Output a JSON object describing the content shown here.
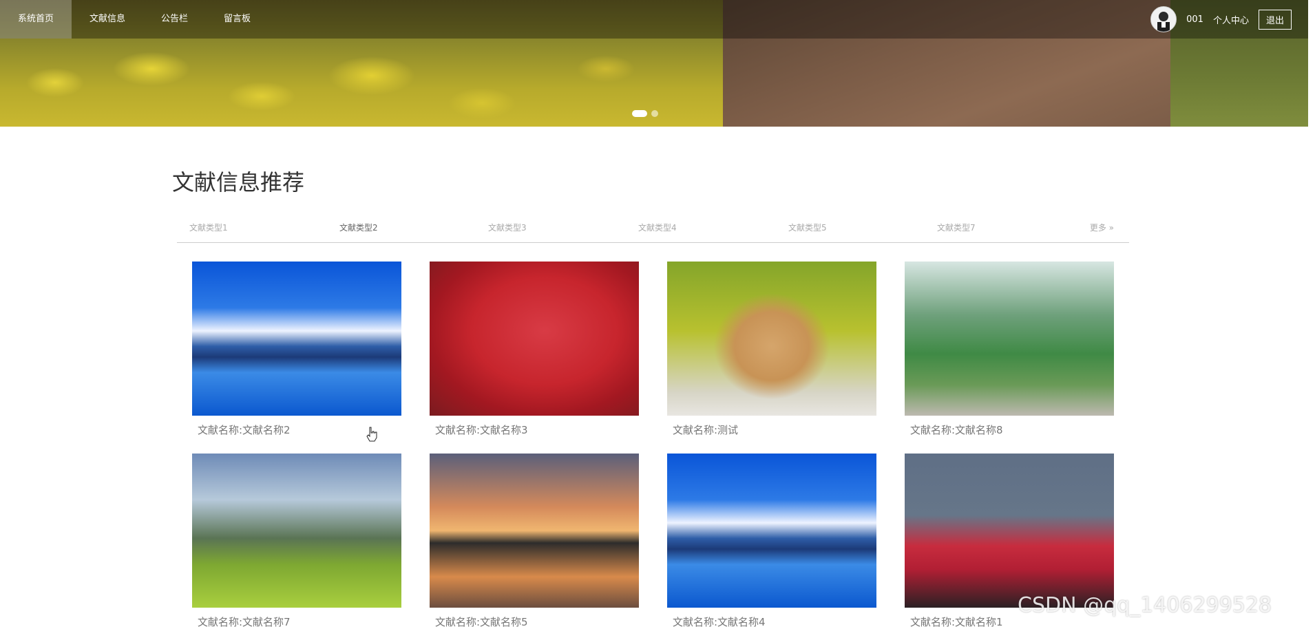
{
  "nav": {
    "items": [
      {
        "label": "系统首页",
        "active": true
      },
      {
        "label": "文献信息",
        "active": false
      },
      {
        "label": "公告栏",
        "active": false
      },
      {
        "label": "留言板",
        "active": false
      }
    ],
    "user": {
      "id_label": "001",
      "center_label": "个人中心",
      "logout_label": "退出"
    }
  },
  "banner": {
    "slides": 2,
    "active_slide": 1
  },
  "section": {
    "title": "文献信息推荐",
    "tabs": [
      "文献类型1",
      "文献类型2",
      "文献类型3",
      "文献类型4",
      "文献类型5",
      "文献类型7"
    ],
    "active_tab": 1,
    "more_label": "更多 »"
  },
  "cards": [
    {
      "caption": "文献名称:文献名称2",
      "image": "mountain-lake"
    },
    {
      "caption": "文献名称:文献名称3",
      "image": "red-maple"
    },
    {
      "caption": "文献名称:测试",
      "image": "rabbit"
    },
    {
      "caption": "文献名称:文献名称8",
      "image": "family-walk"
    },
    {
      "caption": "文献名称:文献名称7",
      "image": "rice-terraces"
    },
    {
      "caption": "文献名称:文献名称5",
      "image": "sunset-trees"
    },
    {
      "caption": "文献名称:文献名称4",
      "image": "mountain-lake"
    },
    {
      "caption": "文献名称:文献名称1",
      "image": "red-peak"
    }
  ],
  "watermark": "CSDN @qq_1406299528",
  "icons": {
    "avatar": "user-avatar-icon",
    "cursor": "hand-pointer-icon"
  }
}
